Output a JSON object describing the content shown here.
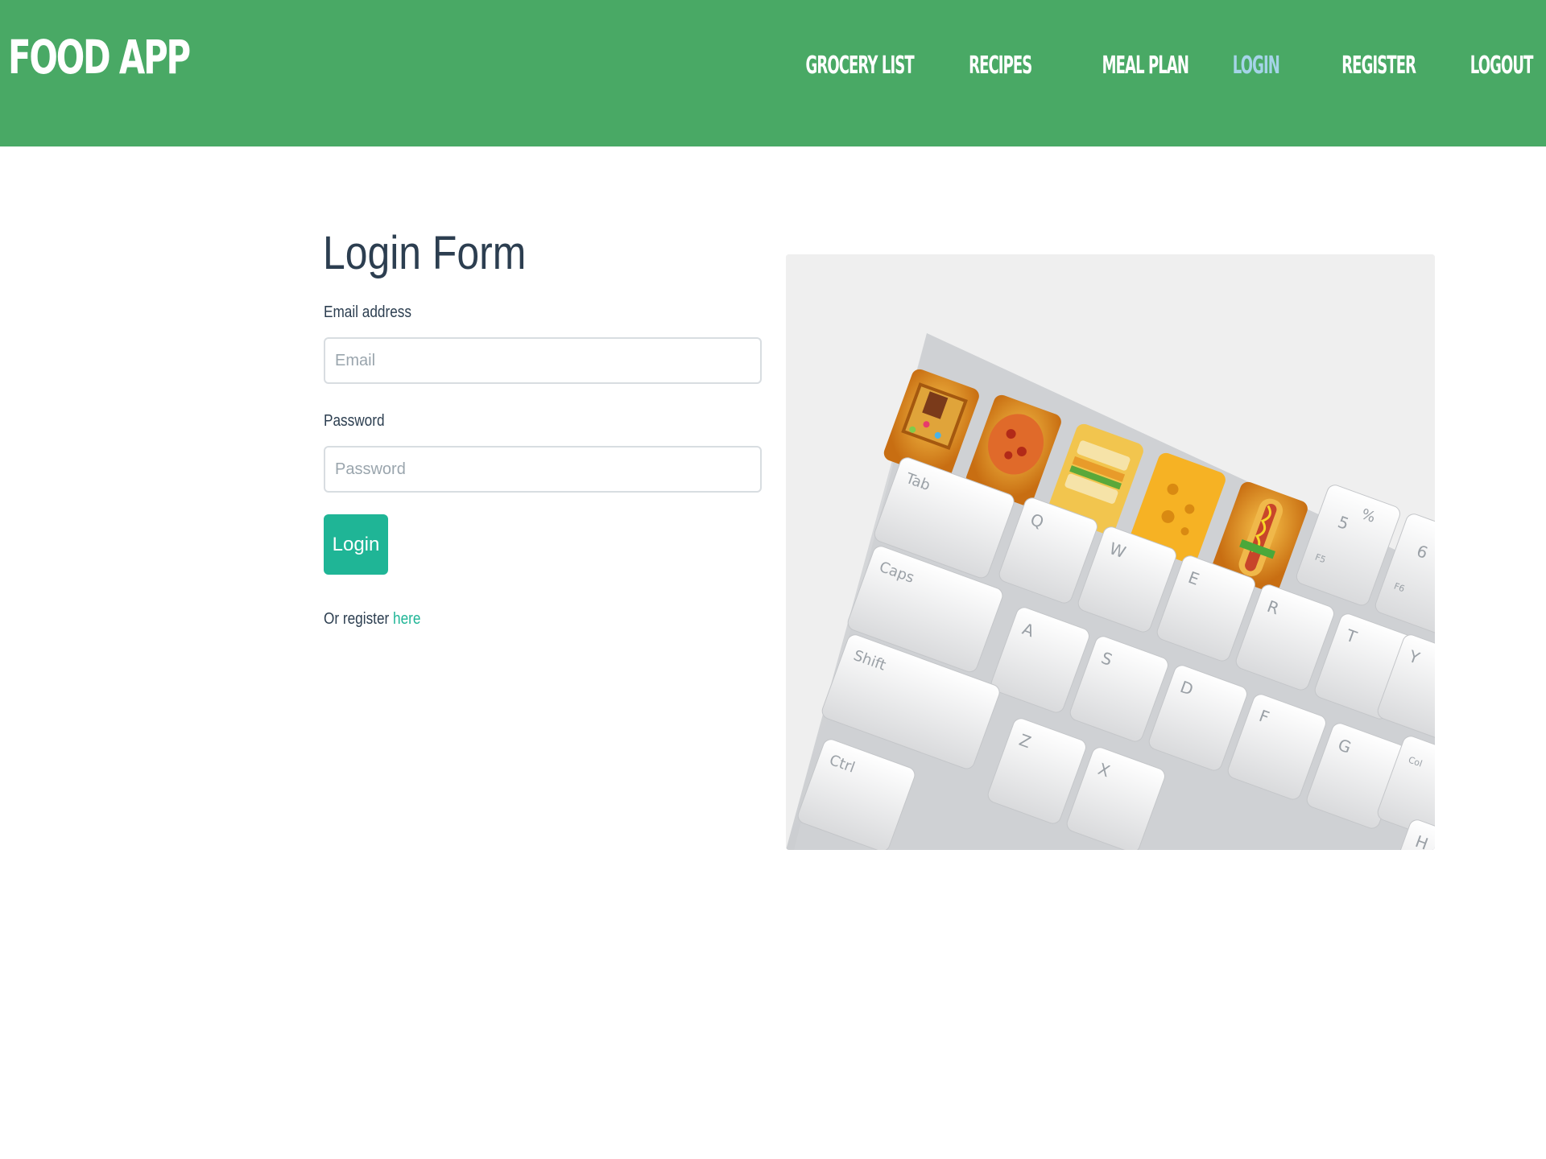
{
  "header": {
    "brand": "FOOD APP",
    "nav": [
      {
        "label": "GROCERY LIST"
      },
      {
        "label": "RECIPES"
      },
      {
        "label": "MEAL PLAN"
      },
      {
        "label": "LOGIN",
        "active": true
      },
      {
        "label": "REGISTER"
      },
      {
        "label": "LOGOUT"
      }
    ]
  },
  "form": {
    "title": "Login Form",
    "email_label": "Email address",
    "email_placeholder": "Email",
    "email_value": "",
    "password_label": "Password",
    "password_placeholder": "Password",
    "password_value": "",
    "submit_label": "Login",
    "register_prefix": "Or register ",
    "register_link": "here"
  },
  "hero": {
    "keys": {
      "tab": "Tab",
      "caps": "Caps",
      "shift": "Shift",
      "ctrl": "Ctrl",
      "q": "Q",
      "w": "W",
      "e": "E",
      "r": "R",
      "t": "T",
      "y": "Y",
      "a": "A",
      "s": "S",
      "d": "D",
      "f": "F",
      "g": "G",
      "z": "Z",
      "x": "X",
      "five": "5",
      "percent": "%",
      "six": "6",
      "caret": "^",
      "f5": "F5",
      "f6": "F6",
      "col": "Col",
      "h": "H"
    }
  },
  "colors": {
    "header_bg": "#49a965",
    "nav_active": "#a5d4e8",
    "accent": "#1fb596",
    "text": "#2c3e50"
  }
}
